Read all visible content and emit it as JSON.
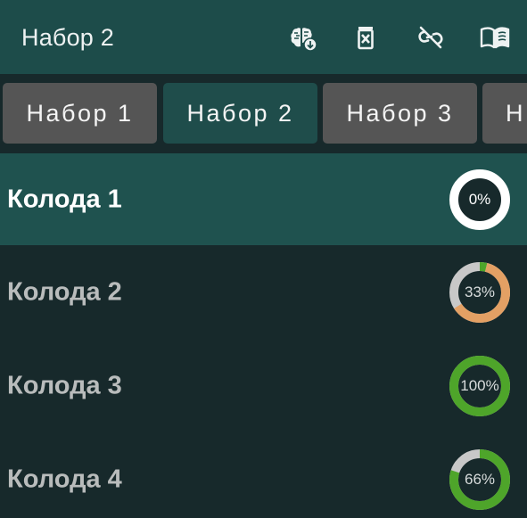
{
  "appbar": {
    "title": "Набор 2",
    "actions": [
      {
        "name": "brain-download-icon",
        "icon": "brain-download"
      },
      {
        "name": "delete-box-icon",
        "icon": "delete-box"
      },
      {
        "name": "link-off-icon",
        "icon": "link-off"
      },
      {
        "name": "book-open-icon",
        "icon": "book-open"
      }
    ]
  },
  "tabs": [
    {
      "label": "Набор 1",
      "active": false
    },
    {
      "label": "Набор 2",
      "active": true
    },
    {
      "label": "Набор 3",
      "active": false
    },
    {
      "label": "Н",
      "active": false
    }
  ],
  "decks": [
    {
      "name": "Колода 1",
      "progress_label": "0%",
      "learned": 0,
      "in_progress": 0,
      "selected": true
    },
    {
      "name": "Колода 2",
      "progress_label": "33%",
      "learned": 0.04,
      "in_progress": 0.62,
      "selected": false
    },
    {
      "name": "Колода 3",
      "progress_label": "100%",
      "learned": 1.0,
      "in_progress": 0,
      "selected": false
    },
    {
      "name": "Колода 4",
      "progress_label": "66%",
      "learned": 0.8,
      "in_progress": 0,
      "selected": false
    }
  ],
  "colors": {
    "appbar_bg": "#1d4c4a",
    "background": "#17292b",
    "tab_bg": "#555555",
    "tab_active_bg": "#1f4d4b",
    "ring_track": "#c8c8c8",
    "ring_empty": "#ffffff",
    "ring_learned": "#4ea52a",
    "ring_in_progress": "#e3a064",
    "ring_center": "#17292b"
  }
}
